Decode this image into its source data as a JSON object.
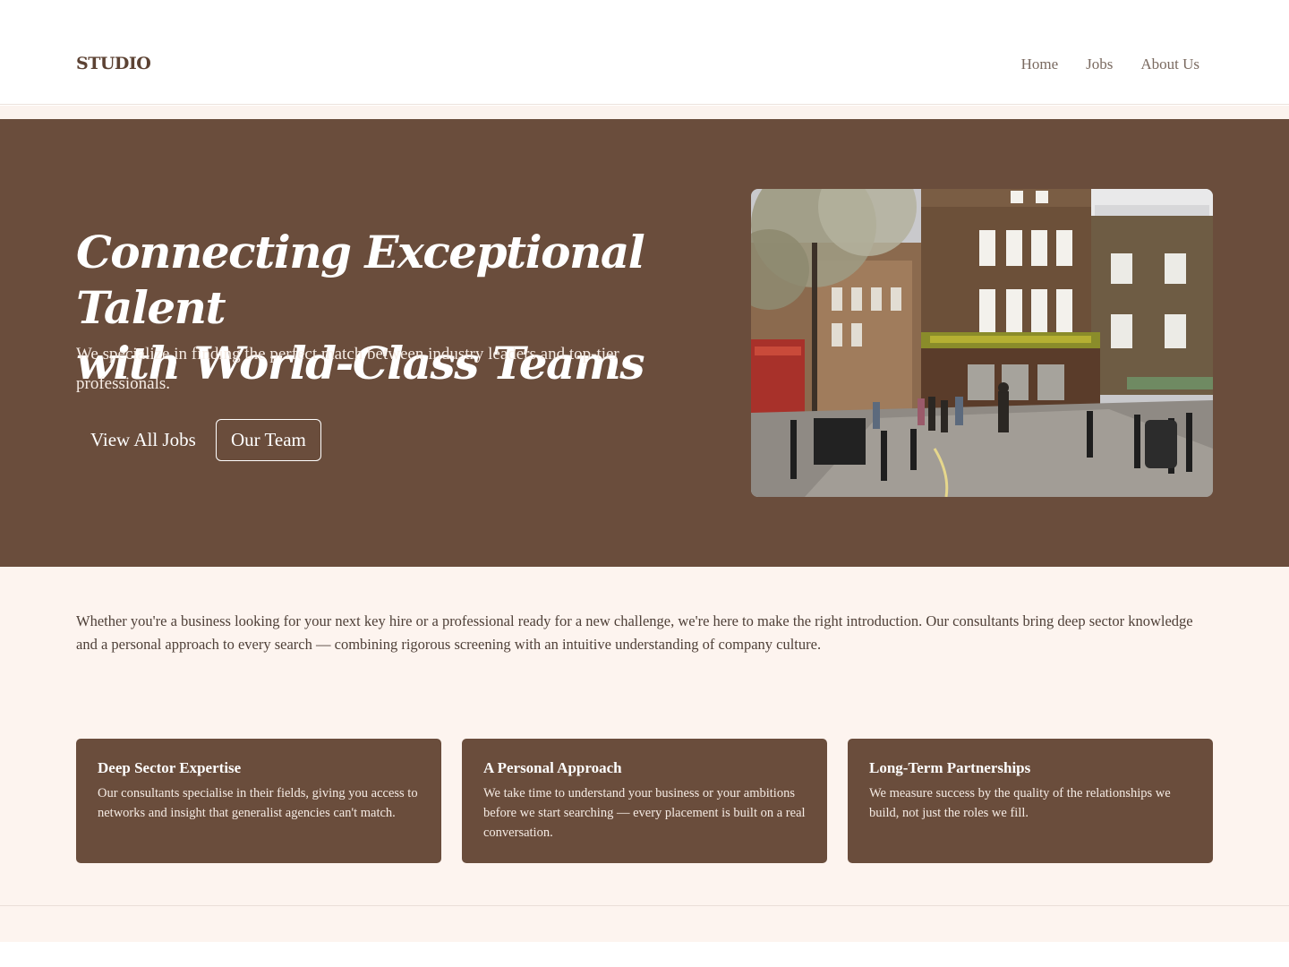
{
  "header": {
    "logo": "STUDIO",
    "nav": [
      "Home",
      "Jobs",
      "About Us"
    ]
  },
  "hero": {
    "title_line1": "Connecting Exceptional Talent",
    "title_line2": "with World-Class Teams",
    "subtitle": "We specialize in finding the perfect match between industry leaders and top-tier professionals.",
    "primary_button": "View All Jobs",
    "secondary_button": "Our Team"
  },
  "intro": {
    "text": "Whether you're a business looking for your next key hire or a professional ready for a new challenge, we're here to make the right introduction. Our consultants bring deep sector knowledge and a personal approach to every search — combining rigorous screening with an intuitive understanding of company culture."
  },
  "features": [
    {
      "title": "Deep Sector Expertise",
      "body": "Our consultants specialise in their fields, giving you access to networks and insight that generalist agencies can't match."
    },
    {
      "title": "A Personal Approach",
      "body": "We take time to understand your business or your ambitions before we start searching — every placement is built on a real conversation."
    },
    {
      "title": "Long-Term Partnerships",
      "body": "We measure success by the quality of the relationships we build, not just the roles we fill."
    }
  ],
  "colors": {
    "brand_brown": "#6a4d3c",
    "cream": "#fdf4ef"
  }
}
